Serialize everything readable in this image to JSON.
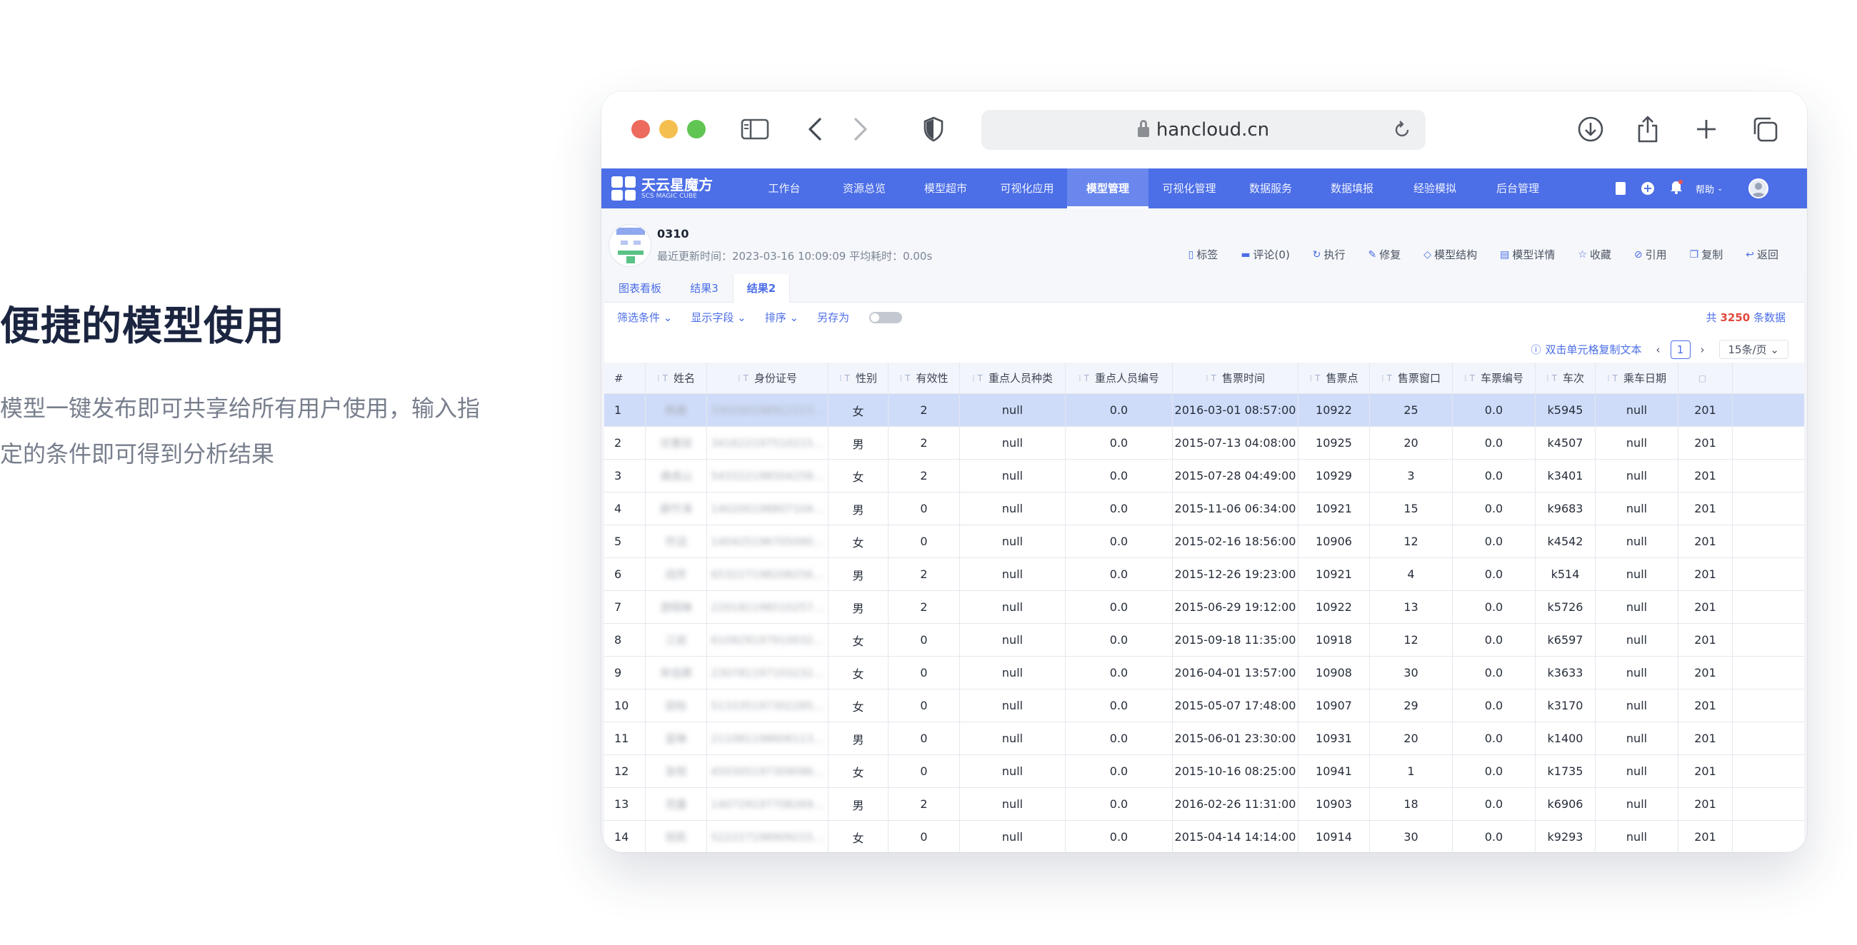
{
  "hero": {
    "title": "便捷的模型使用",
    "description": "模型一键发布即可共享给所有用户使用，输入指定的条件即可得到分析结果"
  },
  "browser": {
    "url": "hancloud.cn",
    "toolbar_icons": [
      "sidebar-icon",
      "back-icon",
      "forward-icon",
      "shield-icon",
      "reload-icon",
      "download-icon",
      "share-icon",
      "new-tab-icon",
      "tabs-overview-icon"
    ]
  },
  "app": {
    "logo": {
      "main": "天云星魔方",
      "sub": "SCS MAGIC CUBE"
    },
    "nav": [
      "工作台",
      "资源总览",
      "模型超市",
      "可视化应用",
      "模型管理",
      "可视化管理",
      "数据服务",
      "数据填报",
      "经验模拟",
      "后台管理"
    ],
    "active_nav": "模型管理",
    "help_label": "帮助",
    "accent_color": "#4c6ee6"
  },
  "model": {
    "name": "0310",
    "meta": "最近更新时间：2023-03-16 10:09:09  平均耗时：0.00s",
    "actions": [
      "标签",
      "评论(0)",
      "执行",
      "修复",
      "模型结构",
      "模型详情",
      "收藏",
      "引用",
      "复制",
      "返回"
    ]
  },
  "tabs": [
    "图表看板",
    "结果3",
    "结果2"
  ],
  "active_tab": "结果2",
  "filters": [
    "筛选条件",
    "显示字段",
    "排序",
    "另存为"
  ],
  "total": {
    "prefix": "共",
    "count": "3250",
    "suffix": "条数据"
  },
  "pager": {
    "copy_hint": "双击单元格复制文本",
    "page": "1",
    "page_size": "15条/页"
  },
  "table": {
    "columns": [
      "#",
      "姓名",
      "身份证号",
      "性别",
      "有效性",
      "重点人员种类",
      "重点人员编号",
      "售票时间",
      "售票点",
      "售票窗口",
      "车票编号",
      "车次",
      "乘车日期"
    ],
    "rows": [
      [
        "1",
        "韩晨",
        "330200198912213…",
        "女",
        "2",
        "null",
        "0.0",
        "2016-03-01 08:57:00",
        "10922",
        "25",
        "0.0",
        "k5945",
        "null",
        "201"
      ],
      [
        "2",
        "伏惠琼",
        "341622197510215…",
        "男",
        "2",
        "null",
        "0.0",
        "2015-07-13 04:08:00",
        "10925",
        "20",
        "0.0",
        "k4507",
        "null",
        "201"
      ],
      [
        "3",
        "谯成山",
        "543322198504258…",
        "女",
        "2",
        "null",
        "0.0",
        "2015-07-28 04:49:00",
        "10929",
        "3",
        "0.0",
        "k3401",
        "null",
        "201"
      ],
      [
        "4",
        "薛竹涛",
        "140200198807104…",
        "男",
        "0",
        "null",
        "0.0",
        "2015-11-06 06:34:00",
        "10921",
        "15",
        "0.0",
        "k9683",
        "null",
        "201"
      ],
      [
        "5",
        "符滔",
        "140425196705090…",
        "女",
        "0",
        "null",
        "0.0",
        "2015-02-16 18:56:00",
        "10906",
        "12",
        "0.0",
        "k4542",
        "null",
        "201"
      ],
      [
        "6",
        "阎芳",
        "653227198208256…",
        "男",
        "2",
        "null",
        "0.0",
        "2015-12-26 19:23:00",
        "10921",
        "4",
        "0.0",
        "k514",
        "null",
        "201"
      ],
      [
        "7",
        "游翔琳",
        "220181198510257…",
        "男",
        "2",
        "null",
        "0.0",
        "2015-06-29 19:12:00",
        "10922",
        "13",
        "0.0",
        "k5726",
        "null",
        "201"
      ],
      [
        "8",
        "江岩",
        "610929197910032…",
        "女",
        "0",
        "null",
        "0.0",
        "2015-09-18 11:35:00",
        "10918",
        "12",
        "0.0",
        "k6597",
        "null",
        "201"
      ],
      [
        "9",
        "宋佳卿",
        "230781197103232…",
        "女",
        "0",
        "null",
        "0.0",
        "2016-04-01 13:57:00",
        "10908",
        "30",
        "0.0",
        "k3633",
        "null",
        "201"
      ],
      [
        "10",
        "田怡",
        "513335197302285…",
        "女",
        "0",
        "null",
        "0.0",
        "2015-05-07 17:48:00",
        "10907",
        "29",
        "0.0",
        "k3170",
        "null",
        "201"
      ],
      [
        "11",
        "蓝琳",
        "211081198606113…",
        "男",
        "0",
        "null",
        "0.0",
        "2015-06-01 23:30:00",
        "10931",
        "20",
        "0.0",
        "k1400",
        "null",
        "201"
      ],
      [
        "12",
        "张悦",
        "450305197309096…",
        "女",
        "0",
        "null",
        "0.0",
        "2015-10-16 08:25:00",
        "10941",
        "1",
        "0.0",
        "k1735",
        "null",
        "201"
      ],
      [
        "13",
        "范露",
        "140729197708269…",
        "男",
        "2",
        "null",
        "0.0",
        "2016-02-26 11:31:00",
        "10903",
        "18",
        "0.0",
        "k6906",
        "null",
        "201"
      ],
      [
        "14",
        "倪凯",
        "522227198909215…",
        "女",
        "0",
        "null",
        "0.0",
        "2015-04-14 14:14:00",
        "10914",
        "30",
        "0.0",
        "k9293",
        "null",
        "201"
      ]
    ],
    "selected_row": 0
  }
}
